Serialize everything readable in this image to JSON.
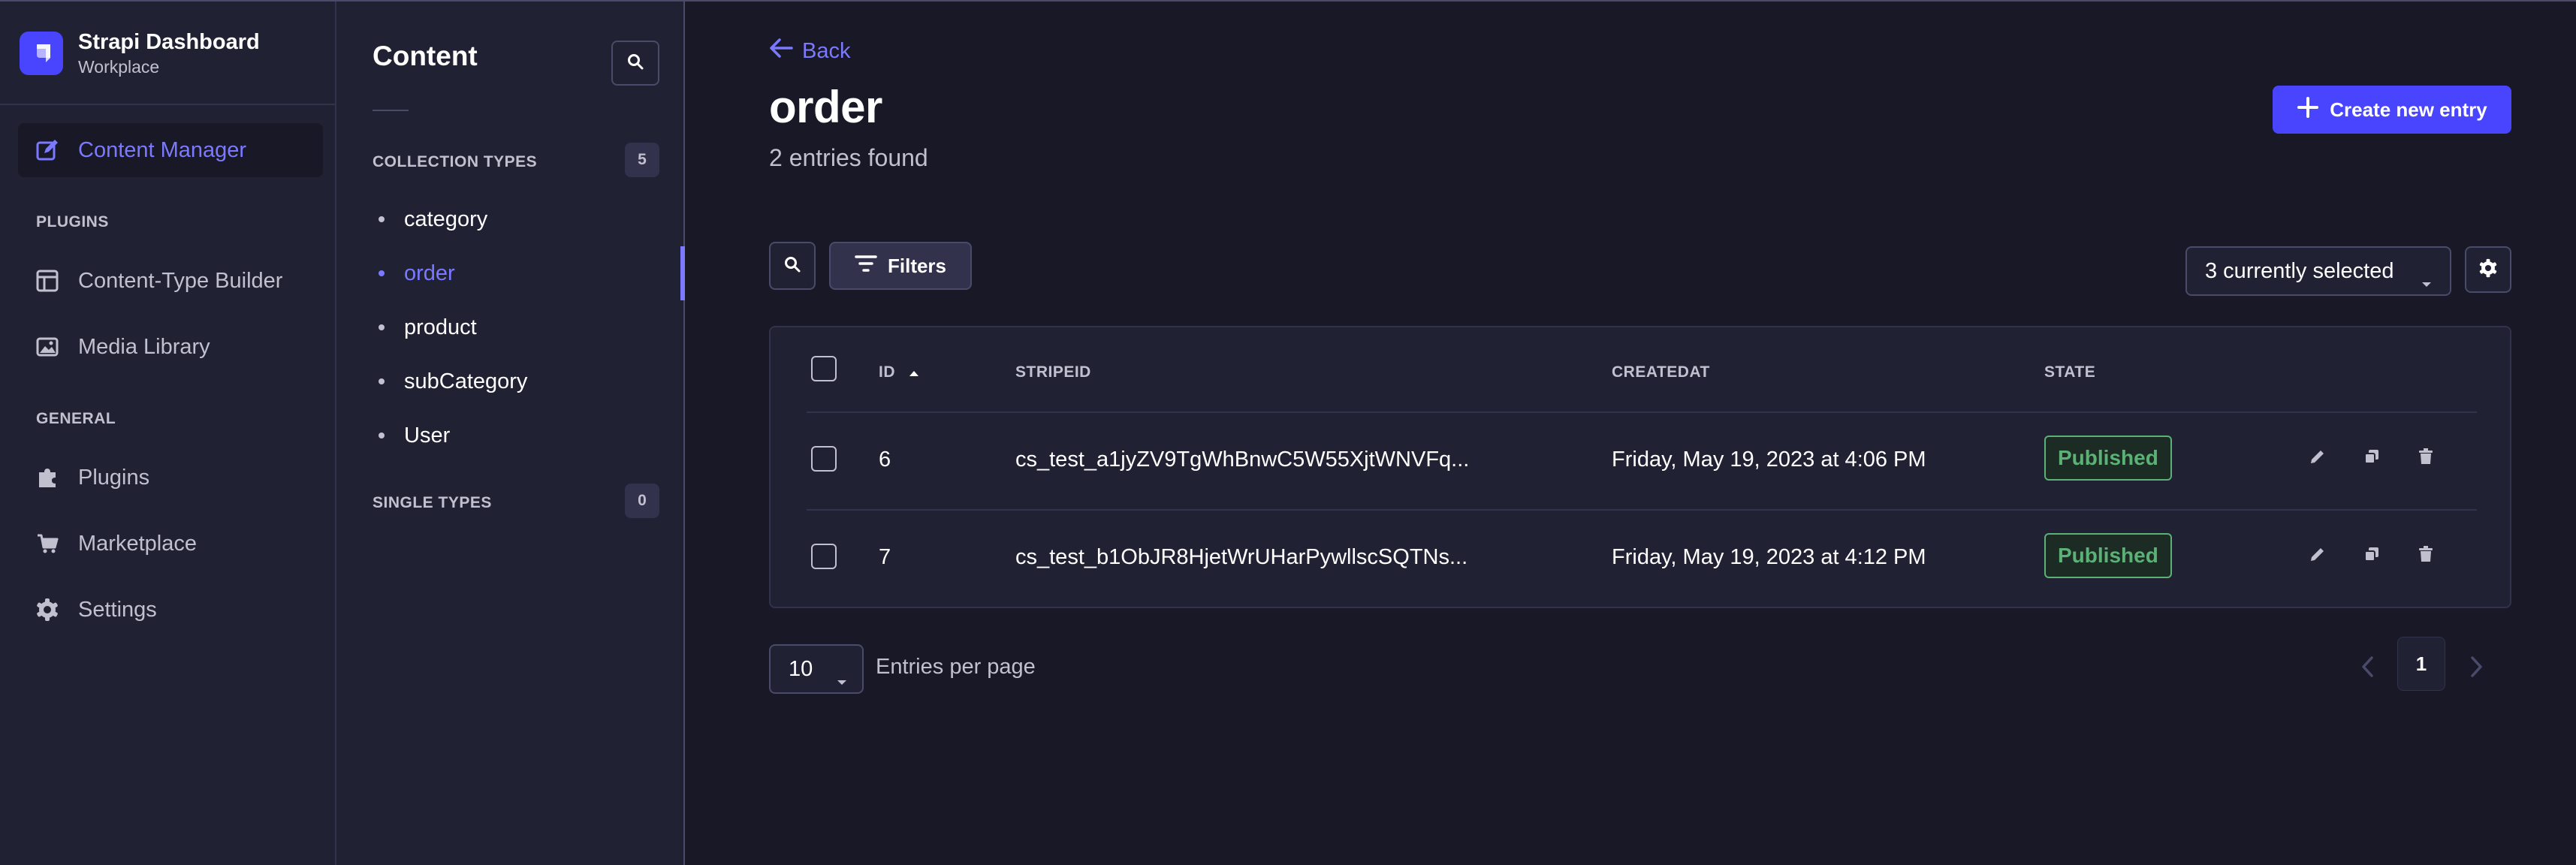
{
  "brand": {
    "title": "Strapi Dashboard",
    "subtitle": "Workplace"
  },
  "left_nav": {
    "active_item": "Content Manager",
    "plugins_heading": "PLUGINS",
    "plugins": [
      "Content-Type Builder",
      "Media Library"
    ],
    "general_heading": "GENERAL",
    "general": [
      "Plugins",
      "Marketplace",
      "Settings"
    ]
  },
  "sub_nav": {
    "title": "Content",
    "collection_heading": "COLLECTION TYPES",
    "collection_count": "5",
    "collection_items": [
      "category",
      "order",
      "product",
      "subCategory",
      "User"
    ],
    "active_item": "order",
    "single_heading": "SINGLE TYPES",
    "single_count": "0"
  },
  "header": {
    "back_label": "Back",
    "title": "order",
    "subtitle": "2 entries found",
    "create_label": "Create new entry"
  },
  "toolbar": {
    "filters_label": "Filters",
    "columns_selected": "3 currently selected"
  },
  "table": {
    "columns": [
      "ID",
      "STRIPEID",
      "CREATEDAT",
      "STATE"
    ],
    "rows": [
      {
        "id": "6",
        "stripeid": "cs_test_a1jyZV9TgWhBnwC5W55XjtWNVFq...",
        "createdat": "Friday, May 19, 2023 at 4:06 PM",
        "state": "Published"
      },
      {
        "id": "7",
        "stripeid": "cs_test_b1ObJR8HjetWrUHarPywllscSQTNs...",
        "createdat": "Friday, May 19, 2023 at 4:12 PM",
        "state": "Published"
      }
    ]
  },
  "pagination": {
    "per_page": "10",
    "per_page_label": "Entries per page",
    "current_page": "1"
  },
  "colors": {
    "accent": "#7b79ff",
    "primary_button": "#4945ff",
    "published": "#5cb176",
    "background": "#181826",
    "surface": "#212134"
  },
  "icons": {
    "brand": "strapi-logo-icon",
    "content_manager": "pen-square-icon",
    "content_type_builder": "layout-icon",
    "media_library": "image-icon",
    "plugins": "puzzle-icon",
    "marketplace": "cart-icon",
    "settings": "gear-icon"
  }
}
